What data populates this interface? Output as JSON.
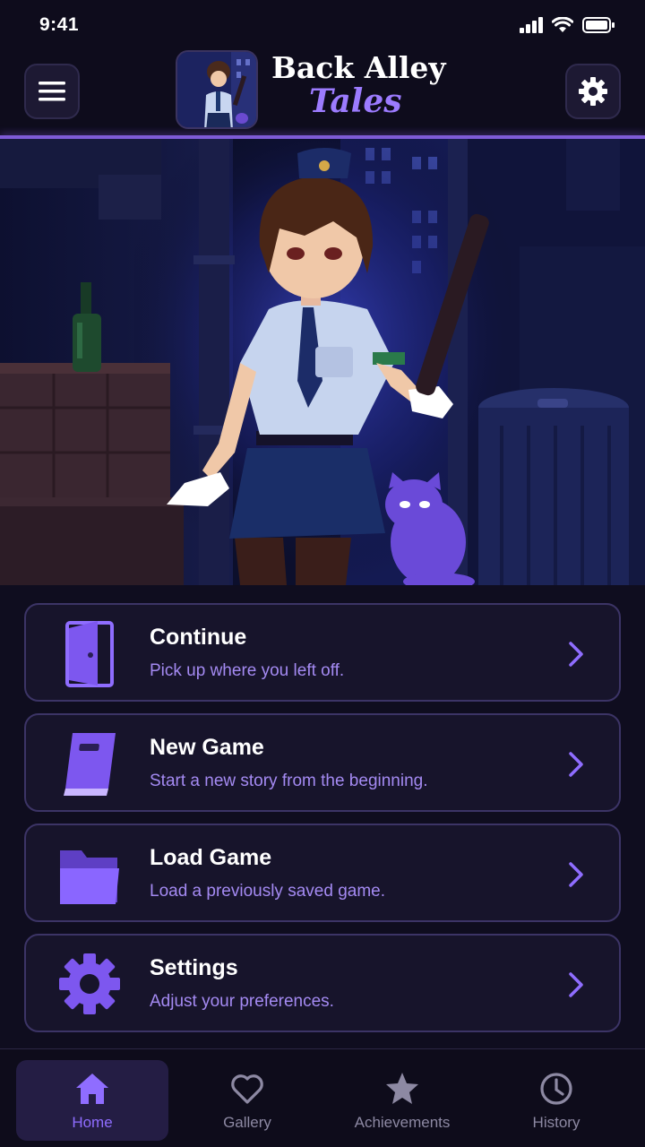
{
  "status_bar": {
    "time": "9:41"
  },
  "header": {
    "title_line1": "Back Alley",
    "title_line2": "Tales"
  },
  "menu": [
    {
      "icon": "door-icon",
      "title": "Continue",
      "subtitle": "Pick up where you left off."
    },
    {
      "icon": "book-icon",
      "title": "New Game",
      "subtitle": "Start a new story from the beginning."
    },
    {
      "icon": "folder-icon",
      "title": "Load Game",
      "subtitle": "Load a previously saved game."
    },
    {
      "icon": "gear-icon",
      "title": "Settings",
      "subtitle": "Adjust your preferences."
    }
  ],
  "nav": [
    {
      "icon": "home-icon",
      "label": "Home",
      "active": true
    },
    {
      "icon": "heart-icon",
      "label": "Gallery",
      "active": false
    },
    {
      "icon": "star-icon",
      "label": "Achievements",
      "active": false
    },
    {
      "icon": "clock-icon",
      "label": "History",
      "active": false
    }
  ],
  "colors": {
    "accent": "#8f6dff",
    "background": "#0f0d1f",
    "card": "#17142b",
    "card_border": "#3c3466",
    "subtitle": "#a48af2"
  }
}
